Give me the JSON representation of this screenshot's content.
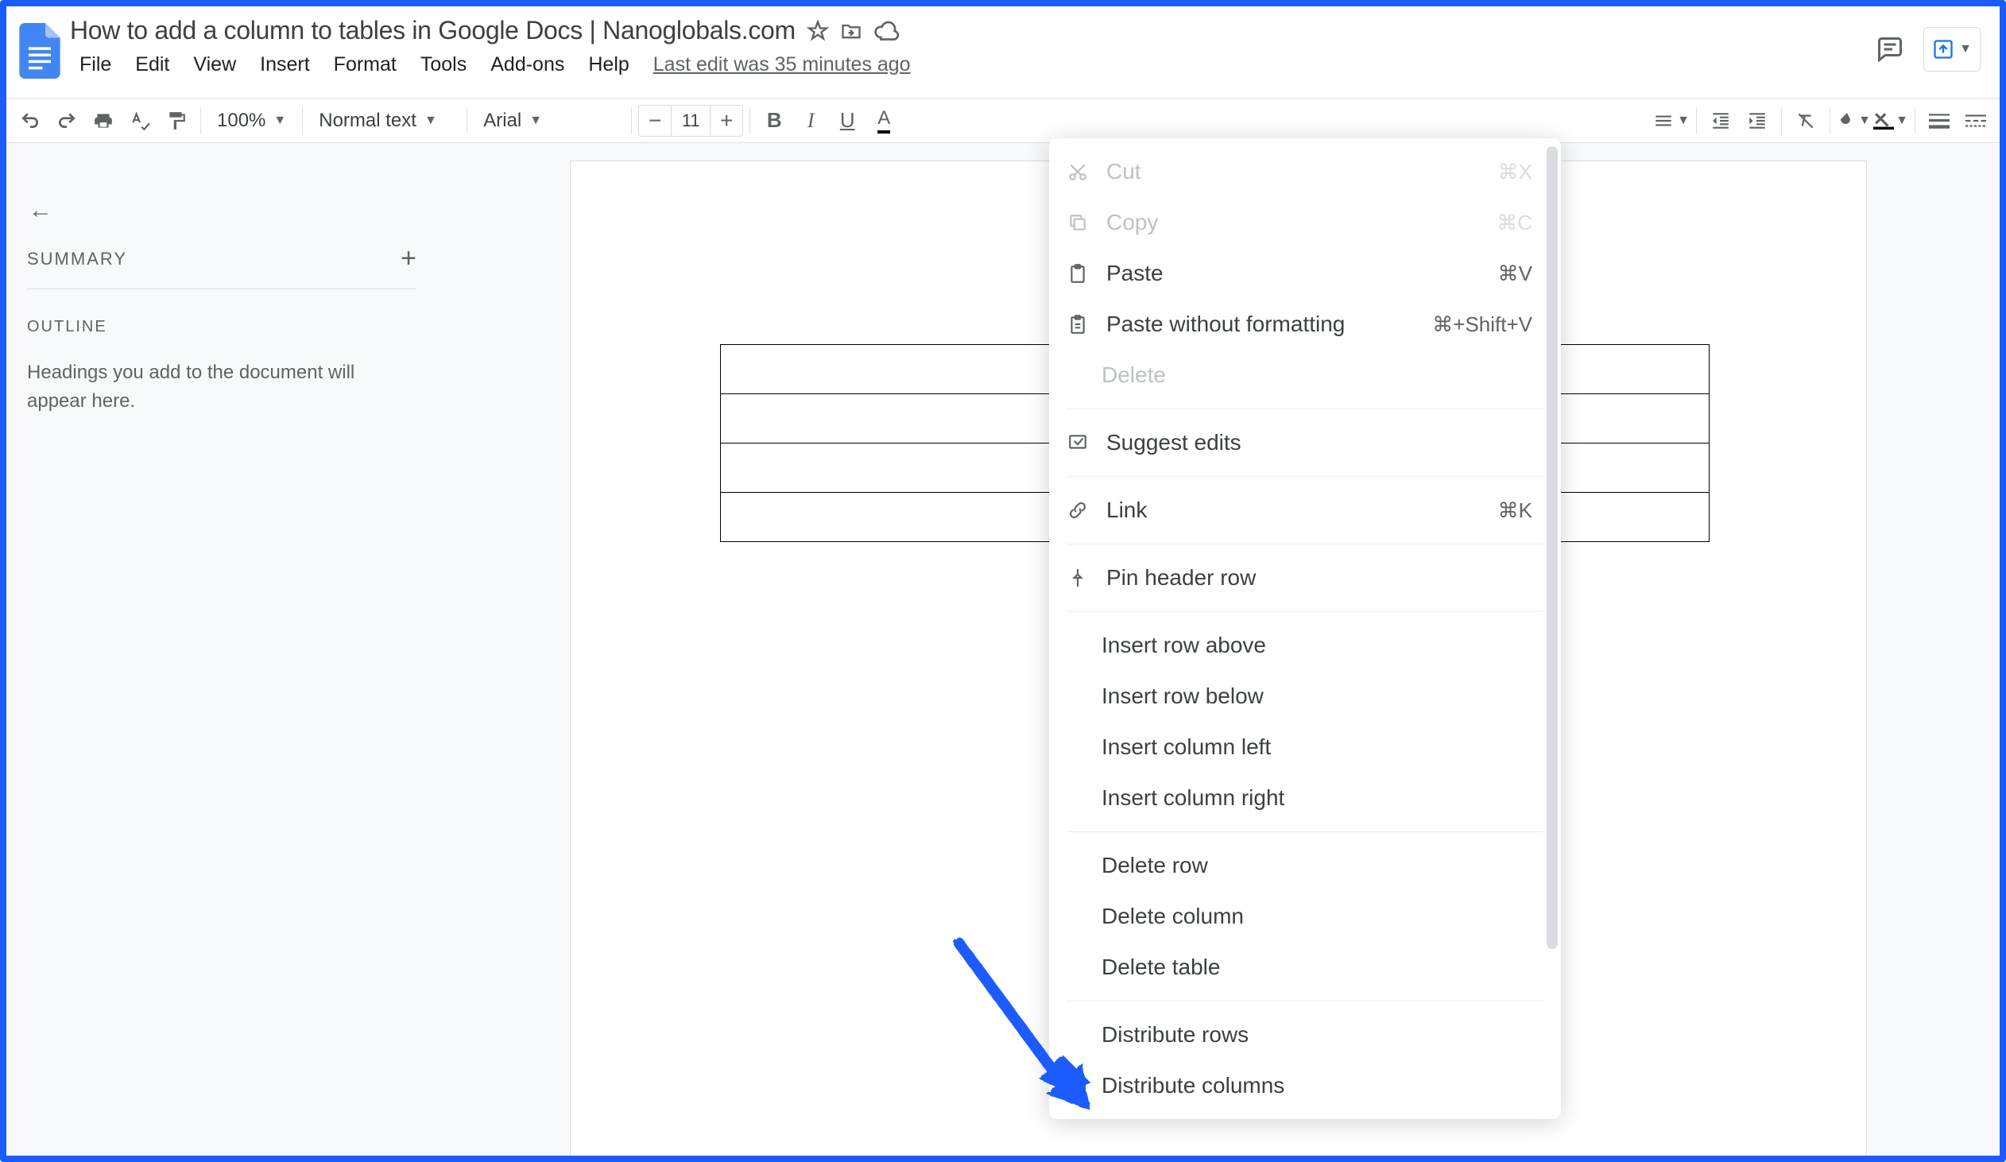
{
  "doc": {
    "title": "How to add a column to tables in Google Docs | Nanoglobals.com",
    "last_edit": "Last edit was 35 minutes ago"
  },
  "menu": {
    "file": "File",
    "edit": "Edit",
    "view": "View",
    "insert": "Insert",
    "format": "Format",
    "tools": "Tools",
    "addons": "Add-ons",
    "help": "Help"
  },
  "toolbar": {
    "zoom": "100%",
    "style": "Normal text",
    "font": "Arial",
    "font_size": "11"
  },
  "side": {
    "summary": "SUMMARY",
    "outline": "Outline",
    "outline_help": "Headings you add to the document will appear here."
  },
  "context": {
    "cut": "Cut",
    "cut_k": "⌘X",
    "copy": "Copy",
    "copy_k": "⌘C",
    "paste": "Paste",
    "paste_k": "⌘V",
    "paste_nf": "Paste without formatting",
    "paste_nf_k": "⌘+Shift+V",
    "delete": "Delete",
    "suggest": "Suggest edits",
    "link": "Link",
    "link_k": "⌘K",
    "pin": "Pin header row",
    "ins_row_above": "Insert row above",
    "ins_row_below": "Insert row below",
    "ins_col_left": "Insert column left",
    "ins_col_right": "Insert column right",
    "del_row": "Delete row",
    "del_col": "Delete column",
    "del_table": "Delete table",
    "dist_rows": "Distribute rows",
    "dist_cols": "Distribute columns"
  }
}
